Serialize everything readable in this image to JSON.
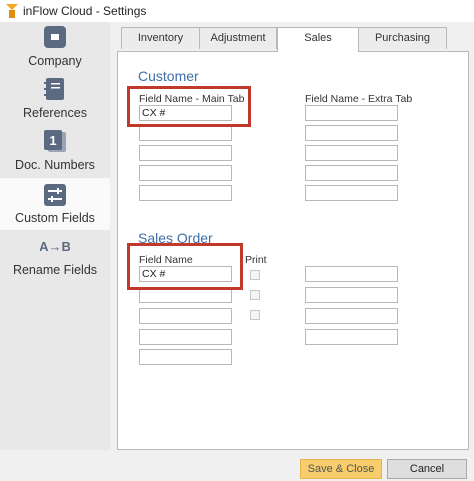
{
  "window": {
    "title": "inFlow Cloud - Settings"
  },
  "sidebar": {
    "items": [
      {
        "label": "Company",
        "icon": "company-icon"
      },
      {
        "label": "References",
        "icon": "references-icon"
      },
      {
        "label": "Doc. Numbers",
        "icon": "doc-numbers-icon",
        "icon_text": "1"
      },
      {
        "label": "Custom Fields",
        "icon": "custom-fields-icon",
        "active": true
      },
      {
        "label": "Rename Fields",
        "icon": "rename-fields-icon",
        "icon_text": "A→B"
      }
    ]
  },
  "tabs": [
    {
      "label": "Inventory"
    },
    {
      "label": "Adjustment"
    },
    {
      "label": "Sales",
      "active": true
    },
    {
      "label": "Purchasing"
    }
  ],
  "customer": {
    "title": "Customer",
    "main_tab_label": "Field Name - Main Tab",
    "extra_tab_label": "Field Name - Extra Tab",
    "main_fields": [
      "CX #",
      "",
      "",
      "",
      ""
    ],
    "extra_fields": [
      "",
      "",
      "",
      "",
      ""
    ]
  },
  "sales_order": {
    "title": "Sales Order",
    "field_name_label": "Field Name",
    "print_label": "Print",
    "fields": [
      "CX #",
      "",
      "",
      "",
      ""
    ],
    "extra_fields": [
      "",
      "",
      "",
      ""
    ]
  },
  "footer": {
    "save_label": "Save & Close",
    "cancel_label": "Cancel"
  },
  "colors": {
    "accent_title": "#3e6fa6",
    "highlight": "#c0392b",
    "save_button": "#f8cd6c",
    "sidebar_icon": "#5b6a80"
  }
}
